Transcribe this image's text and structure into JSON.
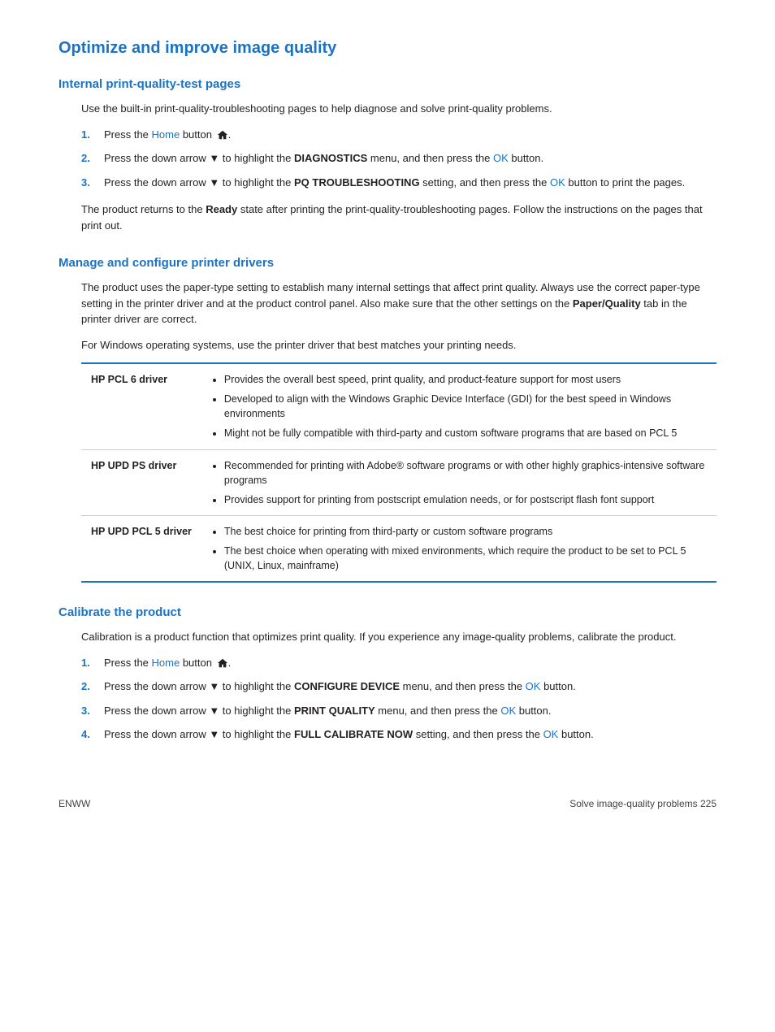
{
  "page": {
    "title": "Optimize and improve image quality"
  },
  "section1": {
    "title": "Internal print-quality-test pages",
    "intro": "Use the built-in print-quality-troubleshooting pages to help diagnose and solve print-quality problems.",
    "steps": [
      {
        "num": "1.",
        "before": "Press the ",
        "home_text": "Home",
        "after": " button ",
        "has_home_icon": true
      },
      {
        "num": "2.",
        "text": "Press the down arrow ▼ to highlight the DIAGNOSTICS menu, and then press the OK button.",
        "ok_word": "OK"
      },
      {
        "num": "3.",
        "text": "Press the down arrow ▼ to highlight the PQ TROUBLESHOOTING setting, and then press the OK button to print the pages.",
        "ok_word": "OK"
      }
    ],
    "closing": "The product returns to the Ready state after printing the print-quality-troubleshooting pages. Follow the instructions on the pages that print out."
  },
  "section2": {
    "title": "Manage and configure printer drivers",
    "para1": "The product uses the paper-type setting to establish many internal settings that affect print quality. Always use the correct paper-type setting in the printer driver and at the product control panel. Also make sure that the other settings on the Paper/Quality tab in the printer driver are correct.",
    "para2": "For Windows operating systems, use the printer driver that best matches your printing needs.",
    "drivers": [
      {
        "name": "HP PCL 6 driver",
        "bullets": [
          "Provides the overall best speed, print quality, and product-feature support for most users",
          "Developed to align with the Windows Graphic Device Interface (GDI) for the best speed in Windows environments",
          "Might not be fully compatible with third-party and custom software programs that are based on PCL 5"
        ]
      },
      {
        "name": "HP UPD PS driver",
        "bullets": [
          "Recommended for printing with Adobe® software programs or with other highly graphics-intensive software programs",
          "Provides support for printing from postscript emulation needs, or for postscript flash font support"
        ]
      },
      {
        "name": "HP UPD PCL 5 driver",
        "bullets": [
          "The best choice for printing from third-party or custom software programs",
          "The best choice when operating with mixed environments, which require the product to be set to PCL 5 (UNIX, Linux, mainframe)"
        ]
      }
    ]
  },
  "section3": {
    "title": "Calibrate the product",
    "intro": "Calibration is a product function that optimizes print quality. If you experience any image-quality problems, calibrate the product.",
    "steps": [
      {
        "num": "1.",
        "type": "home",
        "before": "Press the ",
        "home_text": "Home",
        "after": " button "
      },
      {
        "num": "2.",
        "text": "Press the down arrow ▼ to highlight the CONFIGURE DEVICE menu, and then press the OK button.",
        "ok_word": "OK"
      },
      {
        "num": "3.",
        "text": "Press the down arrow ▼ to highlight the PRINT QUALITY menu, and then press the OK button.",
        "ok_word": "OK"
      },
      {
        "num": "4.",
        "text": "Press the down arrow ▼ to highlight the FULL CALIBRATE NOW setting, and then press the OK button.",
        "ok_word": "OK"
      }
    ]
  },
  "footer": {
    "left": "ENWW",
    "right": "Solve image-quality problems   225"
  }
}
